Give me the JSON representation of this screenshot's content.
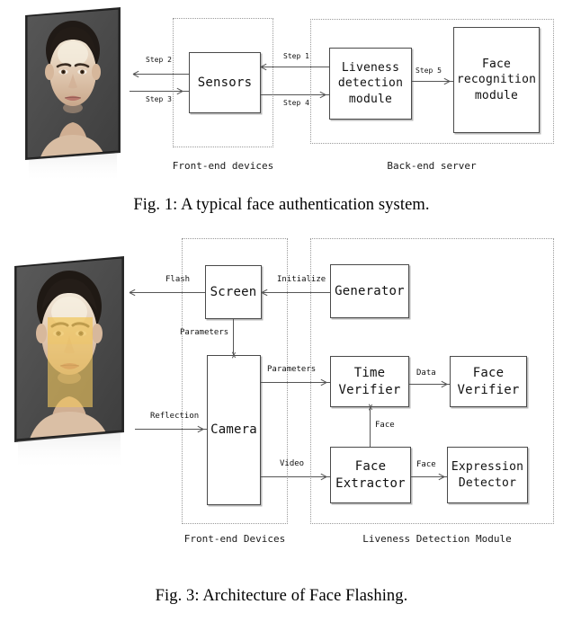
{
  "figure1": {
    "caption": "Fig. 1: A typical face authentication system.",
    "zones": [
      {
        "id": "front-end",
        "label": "Front-end devices"
      },
      {
        "id": "back-end",
        "label": "Back-end server"
      }
    ],
    "nodes": [
      {
        "id": "sensors",
        "label": "Sensors"
      },
      {
        "id": "liveness-module",
        "label": "Liveness\ndetection\nmodule"
      },
      {
        "id": "face-recognition",
        "label": "Face\nrecognition\nmodule"
      }
    ],
    "edges": [
      {
        "id": "step2",
        "label": "Step 2"
      },
      {
        "id": "step3",
        "label": "Step 3"
      },
      {
        "id": "step1",
        "label": "Step 1"
      },
      {
        "id": "step4",
        "label": "Step 4"
      },
      {
        "id": "step5",
        "label": "Step 5"
      }
    ],
    "photo": {
      "alt": "face-photo-neutral"
    }
  },
  "figure3": {
    "caption": "Fig. 3: Architecture of Face Flashing.",
    "zones": [
      {
        "id": "front-end",
        "label": "Front-end Devices"
      },
      {
        "id": "liveness",
        "label": "Liveness Detection Module"
      }
    ],
    "nodes": [
      {
        "id": "screen",
        "label": "Screen"
      },
      {
        "id": "generator",
        "label": "Generator"
      },
      {
        "id": "camera",
        "label": "Camera"
      },
      {
        "id": "time-verifier",
        "label": "Time\nVerifier"
      },
      {
        "id": "face-verifier",
        "label": "Face\nVerifier"
      },
      {
        "id": "face-extractor",
        "label": "Face\nExtractor"
      },
      {
        "id": "expression-detector",
        "label": "Expression\nDetector"
      }
    ],
    "edges": [
      {
        "id": "flash",
        "label": "Flash"
      },
      {
        "id": "initialize",
        "label": "Initialize"
      },
      {
        "id": "parameters1",
        "label": "Parameters"
      },
      {
        "id": "parameters2",
        "label": "Parameters"
      },
      {
        "id": "reflection",
        "label": "Reflection"
      },
      {
        "id": "data",
        "label": "Data"
      },
      {
        "id": "face-up",
        "label": "Face"
      },
      {
        "id": "video",
        "label": "Video"
      },
      {
        "id": "face-right",
        "label": "Face"
      }
    ],
    "photo": {
      "alt": "face-photo-flash-overlay",
      "overlay_color": "#f0c75e"
    }
  },
  "colors": {
    "node_border": "#4a4a4a",
    "node_shadow": "#b9b9b9",
    "zone_border": "#9a9a9a",
    "edge": "#555555",
    "photo_bg": "#4c4c4c",
    "highlight": "#f0c75e"
  }
}
